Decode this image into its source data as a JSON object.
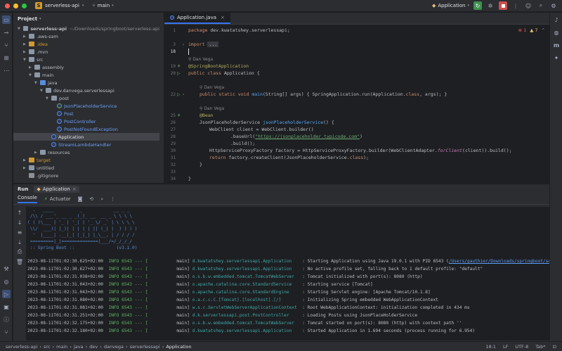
{
  "titlebar": {
    "project_badge": "S",
    "project_name": "serverless-api",
    "branch": "main",
    "run_config": "Application",
    "colors": {
      "run": "#4caf50",
      "stop": "#e04545"
    }
  },
  "project_panel": {
    "title": "Project",
    "tree": [
      {
        "label": "serverless-api",
        "suffix": "~/Downloads/springboot/serverless-api",
        "depth": 0,
        "open": true,
        "kind": "module"
      },
      {
        "label": ".aws-sam",
        "depth": 1,
        "open": false,
        "kind": "folder"
      },
      {
        "label": ".idea",
        "depth": 1,
        "open": false,
        "kind": "folder-orange"
      },
      {
        "label": ".mvn",
        "depth": 1,
        "open": false,
        "kind": "folder"
      },
      {
        "label": "src",
        "depth": 1,
        "open": true,
        "kind": "folder"
      },
      {
        "label": "assembly",
        "depth": 2,
        "open": false,
        "kind": "folder"
      },
      {
        "label": "main",
        "depth": 2,
        "open": true,
        "kind": "folder"
      },
      {
        "label": "java",
        "depth": 3,
        "open": true,
        "kind": "folder-blue"
      },
      {
        "label": "dev.danvega.serverlessapi",
        "depth": 4,
        "open": true,
        "kind": "package"
      },
      {
        "label": "post",
        "depth": 5,
        "open": true,
        "kind": "package"
      },
      {
        "label": "JsonPlaceholderService",
        "depth": 6,
        "kind": "interface"
      },
      {
        "label": "Post",
        "depth": 6,
        "kind": "class"
      },
      {
        "label": "PostController",
        "depth": 6,
        "kind": "class"
      },
      {
        "label": "PostNotFoundException",
        "depth": 6,
        "kind": "class"
      },
      {
        "label": "Application",
        "depth": 5,
        "kind": "class",
        "selected": true
      },
      {
        "label": "StreamLambdaHandler",
        "depth": 5,
        "kind": "class"
      },
      {
        "label": "resources",
        "depth": 3,
        "open": false,
        "kind": "folder"
      },
      {
        "label": "target",
        "depth": 1,
        "open": false,
        "kind": "folder-orange"
      },
      {
        "label": "untitled",
        "depth": 1,
        "open": false,
        "kind": "folder"
      },
      {
        "label": ".gitignore",
        "depth": 1,
        "kind": "file"
      }
    ]
  },
  "editor": {
    "tab": "Application.java",
    "warnings": {
      "errors": "1",
      "warnings": "7"
    },
    "author_hint": "Dan Vega",
    "lines": {
      "l1_num": "1",
      "l1_kw": "package ",
      "l1_rest": "dev.kwatatshey.serverlessapi;",
      "l3_num": "3",
      "l3_kw": "import ",
      "l3_rest": "...",
      "l18_num": "18",
      "l19_num": "19",
      "l19_ann": "@SpringBootApplication",
      "l20_num": "20",
      "l20_kw": "public class ",
      "l20_rest": "Application {",
      "l22_num": "22",
      "l22_kw": "public static void ",
      "l22_fn": "main",
      "l22_rest": "(String[] args) { SpringApplication.run(Application.",
      "l22_kw2": "class",
      "l22_rest2": ", args); }",
      "l25_num": "25",
      "l25_ann": "@Bean",
      "l26_num": "26",
      "l26_pre": "JsonPlaceholderService ",
      "l26_fn": "jsonPlaceholderService",
      "l26_rest": "() {",
      "l27_num": "27",
      "l27_code": "WebClient client = WebClient.builder()",
      "l28_num": "28",
      "l28_pre": ".baseUrl(",
      "l28_str": "\"https://jsonplaceholder.typicode.com\"",
      "l28_post": ")",
      "l29_num": "29",
      "l29_code": ".build();",
      "l30_num": "30",
      "l30_code": "HttpServiceProxyFactory factory = HttpServiceProxyFactory.builder(WebClientAdapter.",
      "l30_it": "forClient",
      "l30_post": "(client)).build();",
      "l31_num": "31",
      "l31_kw": "return ",
      "l31_rest": "factory.createClient(JsonPlaceholderService.",
      "l31_kw2": "class",
      "l31_post": ");",
      "l32_num": "32",
      "l32_code": "}",
      "l33_num": "33",
      "l34_num": "34",
      "l34_code": "}",
      "l35_num": "35"
    }
  },
  "run_panel": {
    "title": "Run",
    "config_tab": "Application",
    "tabs": [
      "Console",
      "Actuator"
    ],
    "banner": [
      "  .   ____          _            __ _ _",
      " /\\\\ / ___'_ __ _ _(_)_ __  __ _ \\ \\ \\ \\",
      "( ( )\\___ | '_ | '_| | '_ \\/ _` | \\ \\ \\ \\",
      " \\\\/  ___)| |_)| | | | | || (_| |  ) ) ) )",
      "  '  |____| .__|_| |_|_| |_\\__, | / / / /",
      " =========|_|==============|___/=/_/_/_/",
      " :: Spring Boot ::                (v3.1.0)"
    ],
    "logs": [
      {
        "ts": "2023-08-11T01:02:30.625+02:00",
        "lvl": "INFO 6543 --- [",
        "thr": "           main]",
        "cls": "d.kwatatshey.serverlessapi.Application   ",
        "msg": ": Starting Application using Java 19.0.1 with PID 6543 (",
        "link": "/Users/gauthier/Downloads/springboot/serverless-ap"
      },
      {
        "ts": "2023-08-11T01:02:30.627+02:00",
        "lvl": "INFO 6543 --- [",
        "thr": "           main]",
        "cls": "d.kwatatshey.serverlessapi.Application   ",
        "msg": ": No active profile set, falling back to 1 default profile: \"default\""
      },
      {
        "ts": "2023-08-11T01:02:31.038+02:00",
        "lvl": "INFO 6543 --- [",
        "thr": "           main]",
        "cls": "o.s.b.w.embedded.tomcat.TomcatWebServer  ",
        "msg": ": Tomcat initialized with port(s): 8080 (http)"
      },
      {
        "ts": "2023-08-11T01:02:31.043+02:00",
        "lvl": "INFO 6543 --- [",
        "thr": "           main]",
        "cls": "o.apache.catalina.core.StandardService   ",
        "msg": ": Starting service [Tomcat]"
      },
      {
        "ts": "2023-08-11T01:02:31.043+02:00",
        "lvl": "INFO 6543 --- [",
        "thr": "           main]",
        "cls": "o.apache.catalina.core.StandardEngine    ",
        "msg": ": Starting Servlet engine: [Apache Tomcat/10.1.8]"
      },
      {
        "ts": "2023-08-11T01:02:31.080+02:00",
        "lvl": "INFO 6543 --- [",
        "thr": "           main]",
        "cls": "o.a.c.c.C.[Tomcat].[localhost].[/]       ",
        "msg": ": Initializing Spring embedded WebApplicationContext"
      },
      {
        "ts": "2023-08-11T01:02:31.081+02:00",
        "lvl": "INFO 6543 --- [",
        "thr": "           main]",
        "cls": "w.s.c.ServletWebServerApplicationContext ",
        "msg": ": Root WebApplicationContext: initialization completed in 434 ms"
      },
      {
        "ts": "2023-08-11T01:02:31.251+02:00",
        "lvl": "INFO 6543 --- [",
        "thr": "           main]",
        "cls": "d.k.serverlessapi.post.PostController    ",
        "msg": ": Loading Posts using JsonPlaceHolderService"
      },
      {
        "ts": "2023-08-11T01:02:32.175+02:00",
        "lvl": "INFO 6543 --- [",
        "thr": "           main]",
        "cls": "o.s.b.w.embedded.tomcat.TomcatWebServer  ",
        "msg": ": Tomcat started on port(s): 8080 (http) with context path ''"
      },
      {
        "ts": "2023-08-11T01:02:32.180+02:00",
        "lvl": "INFO 6543 --- [",
        "thr": "           main]",
        "cls": "d.kwatatshey.serverlessapi.Application   ",
        "msg": ": Started Application in 1.694 seconds (process running for 6.954)"
      }
    ]
  },
  "statusbar": {
    "crumbs": [
      "serverless-api",
      "src",
      "main",
      "java",
      "dev",
      "danvega",
      "serverlessapi",
      "Application"
    ],
    "position": "18:1",
    "line_sep": "LF",
    "encoding": "UTF-8",
    "indent": "Tab*"
  }
}
